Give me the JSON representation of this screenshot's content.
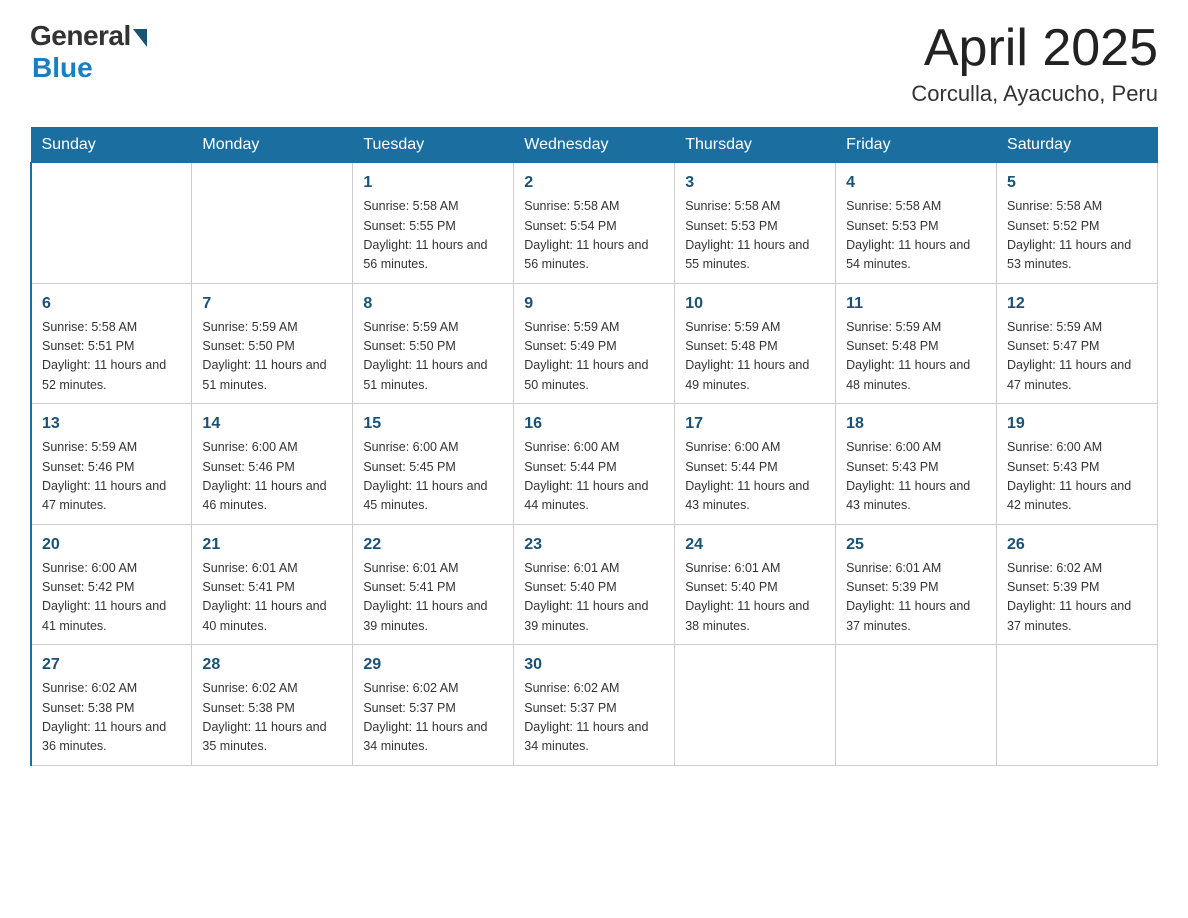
{
  "header": {
    "logo_general": "General",
    "logo_blue": "Blue",
    "month": "April 2025",
    "location": "Corculla, Ayacucho, Peru"
  },
  "weekdays": [
    "Sunday",
    "Monday",
    "Tuesday",
    "Wednesday",
    "Thursday",
    "Friday",
    "Saturday"
  ],
  "weeks": [
    [
      null,
      null,
      {
        "day": 1,
        "sunrise": "5:58 AM",
        "sunset": "5:55 PM",
        "daylight": "11 hours and 56 minutes."
      },
      {
        "day": 2,
        "sunrise": "5:58 AM",
        "sunset": "5:54 PM",
        "daylight": "11 hours and 56 minutes."
      },
      {
        "day": 3,
        "sunrise": "5:58 AM",
        "sunset": "5:53 PM",
        "daylight": "11 hours and 55 minutes."
      },
      {
        "day": 4,
        "sunrise": "5:58 AM",
        "sunset": "5:53 PM",
        "daylight": "11 hours and 54 minutes."
      },
      {
        "day": 5,
        "sunrise": "5:58 AM",
        "sunset": "5:52 PM",
        "daylight": "11 hours and 53 minutes."
      }
    ],
    [
      {
        "day": 6,
        "sunrise": "5:58 AM",
        "sunset": "5:51 PM",
        "daylight": "11 hours and 52 minutes."
      },
      {
        "day": 7,
        "sunrise": "5:59 AM",
        "sunset": "5:50 PM",
        "daylight": "11 hours and 51 minutes."
      },
      {
        "day": 8,
        "sunrise": "5:59 AM",
        "sunset": "5:50 PM",
        "daylight": "11 hours and 51 minutes."
      },
      {
        "day": 9,
        "sunrise": "5:59 AM",
        "sunset": "5:49 PM",
        "daylight": "11 hours and 50 minutes."
      },
      {
        "day": 10,
        "sunrise": "5:59 AM",
        "sunset": "5:48 PM",
        "daylight": "11 hours and 49 minutes."
      },
      {
        "day": 11,
        "sunrise": "5:59 AM",
        "sunset": "5:48 PM",
        "daylight": "11 hours and 48 minutes."
      },
      {
        "day": 12,
        "sunrise": "5:59 AM",
        "sunset": "5:47 PM",
        "daylight": "11 hours and 47 minutes."
      }
    ],
    [
      {
        "day": 13,
        "sunrise": "5:59 AM",
        "sunset": "5:46 PM",
        "daylight": "11 hours and 47 minutes."
      },
      {
        "day": 14,
        "sunrise": "6:00 AM",
        "sunset": "5:46 PM",
        "daylight": "11 hours and 46 minutes."
      },
      {
        "day": 15,
        "sunrise": "6:00 AM",
        "sunset": "5:45 PM",
        "daylight": "11 hours and 45 minutes."
      },
      {
        "day": 16,
        "sunrise": "6:00 AM",
        "sunset": "5:44 PM",
        "daylight": "11 hours and 44 minutes."
      },
      {
        "day": 17,
        "sunrise": "6:00 AM",
        "sunset": "5:44 PM",
        "daylight": "11 hours and 43 minutes."
      },
      {
        "day": 18,
        "sunrise": "6:00 AM",
        "sunset": "5:43 PM",
        "daylight": "11 hours and 43 minutes."
      },
      {
        "day": 19,
        "sunrise": "6:00 AM",
        "sunset": "5:43 PM",
        "daylight": "11 hours and 42 minutes."
      }
    ],
    [
      {
        "day": 20,
        "sunrise": "6:00 AM",
        "sunset": "5:42 PM",
        "daylight": "11 hours and 41 minutes."
      },
      {
        "day": 21,
        "sunrise": "6:01 AM",
        "sunset": "5:41 PM",
        "daylight": "11 hours and 40 minutes."
      },
      {
        "day": 22,
        "sunrise": "6:01 AM",
        "sunset": "5:41 PM",
        "daylight": "11 hours and 39 minutes."
      },
      {
        "day": 23,
        "sunrise": "6:01 AM",
        "sunset": "5:40 PM",
        "daylight": "11 hours and 39 minutes."
      },
      {
        "day": 24,
        "sunrise": "6:01 AM",
        "sunset": "5:40 PM",
        "daylight": "11 hours and 38 minutes."
      },
      {
        "day": 25,
        "sunrise": "6:01 AM",
        "sunset": "5:39 PM",
        "daylight": "11 hours and 37 minutes."
      },
      {
        "day": 26,
        "sunrise": "6:02 AM",
        "sunset": "5:39 PM",
        "daylight": "11 hours and 37 minutes."
      }
    ],
    [
      {
        "day": 27,
        "sunrise": "6:02 AM",
        "sunset": "5:38 PM",
        "daylight": "11 hours and 36 minutes."
      },
      {
        "day": 28,
        "sunrise": "6:02 AM",
        "sunset": "5:38 PM",
        "daylight": "11 hours and 35 minutes."
      },
      {
        "day": 29,
        "sunrise": "6:02 AM",
        "sunset": "5:37 PM",
        "daylight": "11 hours and 34 minutes."
      },
      {
        "day": 30,
        "sunrise": "6:02 AM",
        "sunset": "5:37 PM",
        "daylight": "11 hours and 34 minutes."
      },
      null,
      null,
      null
    ]
  ]
}
